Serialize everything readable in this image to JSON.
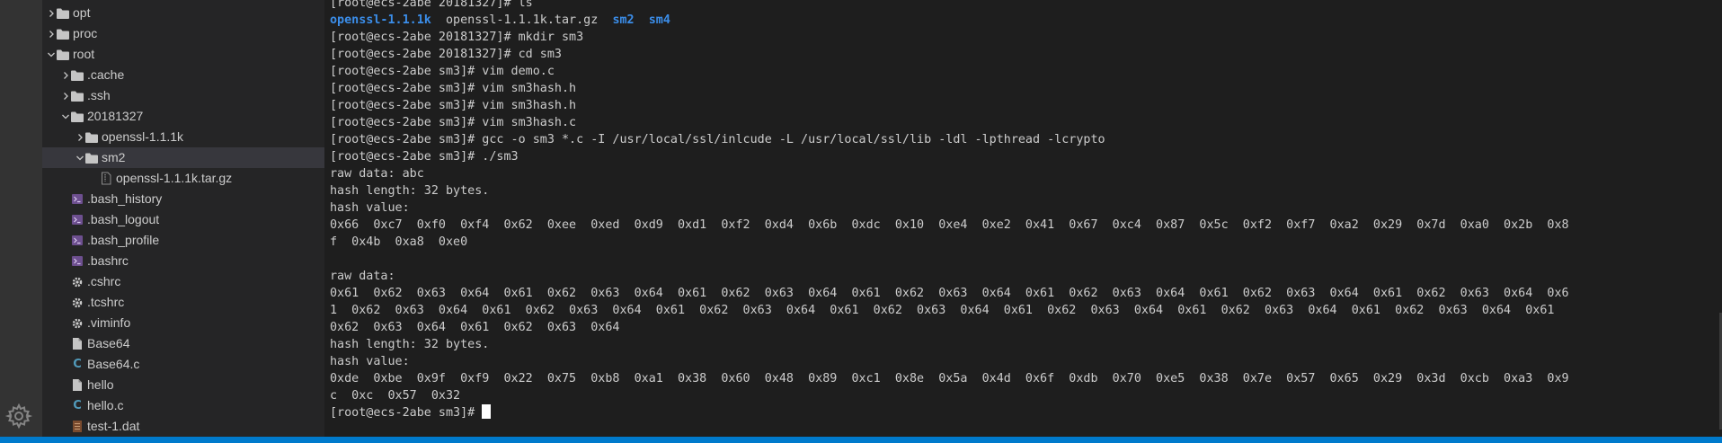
{
  "explorer": {
    "items": [
      {
        "label": "opt",
        "kind": "folder",
        "expanded": false,
        "depth": 0
      },
      {
        "label": "proc",
        "kind": "folder",
        "expanded": false,
        "depth": 0
      },
      {
        "label": "root",
        "kind": "folder",
        "expanded": true,
        "depth": 0
      },
      {
        "label": ".cache",
        "kind": "folder",
        "expanded": false,
        "depth": 1
      },
      {
        "label": ".ssh",
        "kind": "folder",
        "expanded": false,
        "depth": 1
      },
      {
        "label": "20181327",
        "kind": "folder",
        "expanded": true,
        "depth": 1
      },
      {
        "label": "openssl-1.1.1k",
        "kind": "folder",
        "expanded": false,
        "depth": 2
      },
      {
        "label": "sm2",
        "kind": "folder",
        "expanded": true,
        "depth": 2,
        "selected": true
      },
      {
        "label": "openssl-1.1.1k.tar.gz",
        "kind": "archive",
        "depth": 3
      },
      {
        "label": ".bash_history",
        "kind": "shell",
        "depth": 1
      },
      {
        "label": ".bash_logout",
        "kind": "shell",
        "depth": 1
      },
      {
        "label": ".bash_profile",
        "kind": "shell",
        "depth": 1
      },
      {
        "label": ".bashrc",
        "kind": "shell",
        "depth": 1
      },
      {
        "label": ".cshrc",
        "kind": "config",
        "depth": 1
      },
      {
        "label": ".tcshrc",
        "kind": "config",
        "depth": 1
      },
      {
        "label": ".viminfo",
        "kind": "config",
        "depth": 1
      },
      {
        "label": "Base64",
        "kind": "file",
        "depth": 1
      },
      {
        "label": "Base64.c",
        "kind": "c-source",
        "depth": 1
      },
      {
        "label": "hello",
        "kind": "file",
        "depth": 1
      },
      {
        "label": "hello.c",
        "kind": "c-source",
        "depth": 1
      },
      {
        "label": "test-1.dat",
        "kind": "data",
        "depth": 1
      }
    ]
  },
  "activity_bar": {
    "settings_icon": "gear-icon"
  },
  "terminal": {
    "lines": [
      "[root@ecs-2abe 20181327]# ls",
      {
        "ls": [
          {
            "text": "openssl-1.1.1k",
            "dir": true
          },
          {
            "text": "openssl-1.1.1k.tar.gz",
            "dir": false
          },
          {
            "text": "sm2",
            "dir": true
          },
          {
            "text": "sm4",
            "dir": true
          }
        ]
      },
      "[root@ecs-2abe 20181327]# mkdir sm3",
      "[root@ecs-2abe 20181327]# cd sm3",
      "[root@ecs-2abe sm3]# vim demo.c",
      "[root@ecs-2abe sm3]# vim sm3hash.h",
      "[root@ecs-2abe sm3]# vim sm3hash.h",
      "[root@ecs-2abe sm3]# vim sm3hash.c",
      "[root@ecs-2abe sm3]# gcc -o sm3 *.c -I /usr/local/ssl/inlcude -L /usr/local/ssl/lib -ldl -lpthread -lcrypto",
      "[root@ecs-2abe sm3]# ./sm3",
      "raw data: abc",
      "hash length: 32 bytes.",
      "hash value:",
      "0x66  0xc7  0xf0  0xf4  0x62  0xee  0xed  0xd9  0xd1  0xf2  0xd4  0x6b  0xdc  0x10  0xe4  0xe2  0x41  0x67  0xc4  0x87  0x5c  0xf2  0xf7  0xa2  0x29  0x7d  0xa0  0x2b  0x8",
      "f  0x4b  0xa8  0xe0",
      "",
      "raw data:",
      "0x61  0x62  0x63  0x64  0x61  0x62  0x63  0x64  0x61  0x62  0x63  0x64  0x61  0x62  0x63  0x64  0x61  0x62  0x63  0x64  0x61  0x62  0x63  0x64  0x61  0x62  0x63  0x64  0x6",
      "1  0x62  0x63  0x64  0x61  0x62  0x63  0x64  0x61  0x62  0x63  0x64  0x61  0x62  0x63  0x64  0x61  0x62  0x63  0x64  0x61  0x62  0x63  0x64  0x61  0x62  0x63  0x64  0x61",
      "0x62  0x63  0x64  0x61  0x62  0x63  0x64",
      "hash length: 32 bytes.",
      "hash value:",
      "0xde  0xbe  0x9f  0xf9  0x22  0x75  0xb8  0xa1  0x38  0x60  0x48  0x89  0xc1  0x8e  0x5a  0x4d  0x6f  0xdb  0x70  0xe5  0x38  0x7e  0x57  0x65  0x29  0x3d  0xcb  0xa3  0x9",
      "c  0xc  0x57  0x32"
    ],
    "prompt": "[root@ecs-2abe sm3]# "
  },
  "colors": {
    "terminal_bg": "#1e1e1e",
    "sidebar_bg": "#252526",
    "directory_text": "#3b8eea",
    "status_bar": "#007acc"
  }
}
